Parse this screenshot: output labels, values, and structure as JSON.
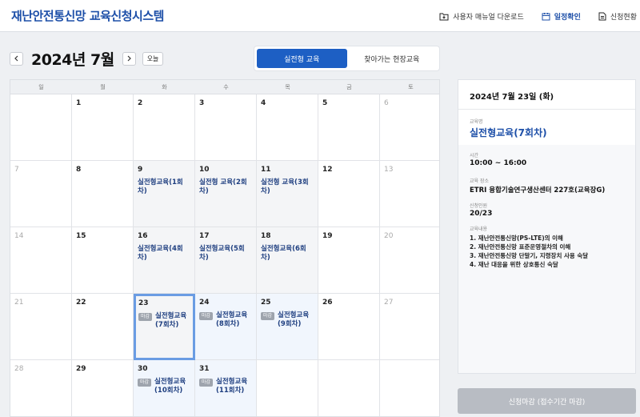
{
  "header": {
    "title": "재난안전통신망 교육신청시스템",
    "nav": [
      {
        "label": "사용자 매뉴얼 다운로드",
        "icon": "folder-download-icon",
        "active": false
      },
      {
        "label": "일정확인",
        "icon": "calendar-icon",
        "active": true
      },
      {
        "label": "신청현황",
        "icon": "document-icon",
        "active": false
      }
    ]
  },
  "toolbar": {
    "prev_icon": "chevron-left-icon",
    "next_icon": "chevron-right-icon",
    "month": "2024년 7월",
    "today_label": "오늘"
  },
  "tabs": [
    {
      "label": "실전형 교육",
      "active": true
    },
    {
      "label": "찾아가는 현장교육",
      "active": false
    }
  ],
  "calendar": {
    "weekdays": [
      "일",
      "월",
      "화",
      "수",
      "목",
      "금",
      "토"
    ],
    "weeks": [
      [
        {
          "day": "",
          "muted": false
        },
        {
          "day": "1"
        },
        {
          "day": "2"
        },
        {
          "day": "3"
        },
        {
          "day": "4"
        },
        {
          "day": "5"
        },
        {
          "day": "6",
          "muted": true
        }
      ],
      [
        {
          "day": "7",
          "muted": true
        },
        {
          "day": "8"
        },
        {
          "day": "9",
          "event": "실전형교육(1회차)",
          "state": "past"
        },
        {
          "day": "10",
          "event": "실전형 교육(2회차)",
          "state": "past"
        },
        {
          "day": "11",
          "event": "실전형 교육(3회차)",
          "state": "past"
        },
        {
          "day": "12"
        },
        {
          "day": "13",
          "muted": true
        }
      ],
      [
        {
          "day": "14",
          "muted": true
        },
        {
          "day": "15"
        },
        {
          "day": "16",
          "event": "실전형교육(4회차)",
          "state": "past"
        },
        {
          "day": "17",
          "event": "실전형교육(5회차)",
          "state": "past"
        },
        {
          "day": "18",
          "event": "실전형교육(6회차)",
          "state": "past"
        },
        {
          "day": "19"
        },
        {
          "day": "20",
          "muted": true
        }
      ],
      [
        {
          "day": "21",
          "muted": true
        },
        {
          "day": "22"
        },
        {
          "day": "23",
          "event": "실전형교육(7회차)",
          "badge": "마감",
          "state": "selected"
        },
        {
          "day": "24",
          "event": "실전형교육(8회차)",
          "badge": "마감",
          "state": "open"
        },
        {
          "day": "25",
          "event": "실전형교육(9회차)",
          "badge": "마감",
          "state": "open"
        },
        {
          "day": "26"
        },
        {
          "day": "27",
          "muted": true
        }
      ],
      [
        {
          "day": "28",
          "muted": true
        },
        {
          "day": "29"
        },
        {
          "day": "30",
          "event": "실전형교육(10회차)",
          "badge": "마감",
          "state": "open"
        },
        {
          "day": "31",
          "event": "실전형교육(11회차)",
          "badge": "마감",
          "state": "open"
        },
        {
          "day": ""
        },
        {
          "day": ""
        },
        {
          "day": ""
        }
      ]
    ]
  },
  "panel": {
    "date": "2024년 7월 23일 (화)",
    "course_label": "교육명",
    "course_name": "실전형교육(7회차)",
    "time_label": "시간",
    "time": "10:00 ~ 16:00",
    "place_label": "교육 장소",
    "place": "ETRI 융합기술연구생산센터 227호(교육장G)",
    "applicants_label": "신청인원",
    "applicants": "20/23",
    "content_label": "교육내용",
    "content": [
      "1. 재난안전통신망(PS-LTE)의 이해",
      "2. 재난안전통신망 표준운영절차의 이해",
      "3. 재난안전통신망 단말기, 지령장치 사용 숙달",
      "4. 재난 대응을 위한 상호통신 숙달"
    ]
  },
  "apply_button": "신청마감 (접수기간 마감)",
  "colors": {
    "brand": "#1d4fa8",
    "tab_active": "#1d5fc4",
    "badge": "#9ea4ad",
    "selected_border": "#6a9ce3",
    "disabled_button": "#b8bcc3"
  }
}
